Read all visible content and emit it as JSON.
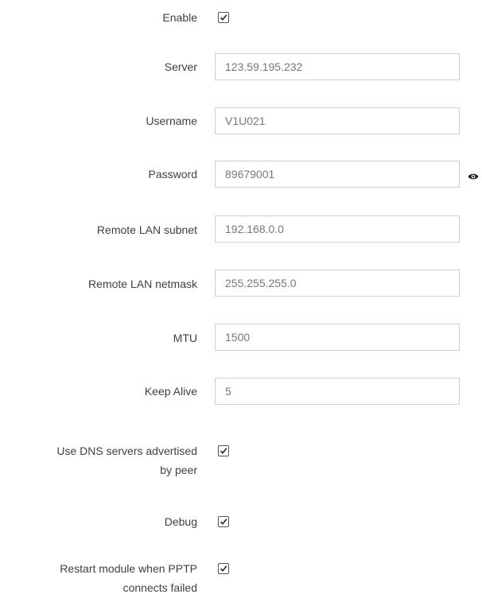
{
  "form": {
    "enable": {
      "label": "Enable",
      "checked": true
    },
    "server": {
      "label": "Server",
      "value": "123.59.195.232"
    },
    "username": {
      "label": "Username",
      "value": "V1U021"
    },
    "password": {
      "label": "Password",
      "value": "89679001",
      "reveal_icon": "eye-icon"
    },
    "remote_lan_subnet": {
      "label": "Remote LAN subnet",
      "value": "192.168.0.0"
    },
    "remote_lan_netmask": {
      "label": "Remote LAN netmask",
      "value": "255.255.255.0"
    },
    "mtu": {
      "label": "MTU",
      "value": "1500"
    },
    "keep_alive": {
      "label": "Keep Alive",
      "value": "5"
    },
    "use_dns": {
      "label_line1": "Use DNS servers advertised",
      "label_line2": "by peer",
      "checked": true
    },
    "debug": {
      "label": "Debug",
      "checked": true
    },
    "restart_module": {
      "label_line1": "Restart module when PPTP",
      "label_line2": "connects failed",
      "checked": true
    }
  },
  "colors": {
    "text": "#404040",
    "input_text": "#777777",
    "input_border": "#cfcfcf"
  }
}
